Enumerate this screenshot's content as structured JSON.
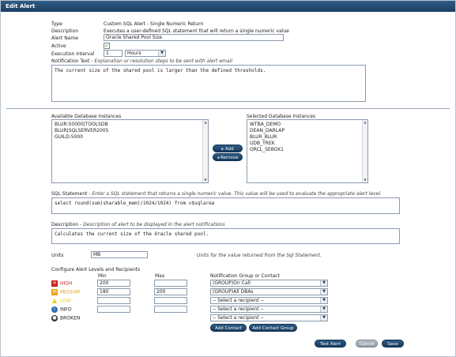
{
  "window": {
    "title": "Edit Alert"
  },
  "form": {
    "type_label": "Type",
    "type_value": "Custom SQL Alert - Single Numeric Return",
    "description_label": "Description",
    "description_value": "Executes a user-defined SQL statement that will return a single numeric value",
    "alert_name_label": "Alert Name",
    "alert_name_value": "Oracle Shared Pool Size",
    "active_label": "Active",
    "active_checked": true,
    "exec_interval_label": "Execution Interval",
    "exec_interval_value": "1",
    "exec_interval_unit": "Hours",
    "notification_text_label": "Notification Text",
    "notification_text_hint": " - Explanation or resolution steps to be sent with alert email",
    "notification_text_value": "The current size of the shared pool is larger than the defined thresholds."
  },
  "instances": {
    "available_label": "Available Database Instances",
    "available": [
      "BLUR:50000|TOOLSDB",
      "BLUR|SQLSERVER2005",
      "GUILD:5000"
    ],
    "selected_label": "Selected Database Instances",
    "selected": [
      "WTBA_DEMO",
      "DEAN_DARLAP",
      "BLUR_BLUR",
      "UDB_TREK",
      "ORCL_SEBOX1"
    ],
    "add_label": "Add",
    "remove_label": "Remove"
  },
  "sql": {
    "label": "SQL Statement",
    "hint": " - Enter a SQL statement that returns a single numeric value. This value will be used to evaluate the appropriate alert level.",
    "value": "select round(sum(sharable_mem)/1024/1024) from v$sqlarea"
  },
  "desc": {
    "label": "Description",
    "hint": " - Description of alert to be displayed in the alert notifications",
    "value": "Calculates the current size of the Oracle shared pool."
  },
  "units": {
    "label": "Units",
    "value": "MB",
    "hint": "Units for the value returned from the Sql Statement."
  },
  "levels": {
    "header": "Configure Alert Levels and Recipients",
    "min_label": "Min",
    "max_label": "Max",
    "recipient_label": "Notification Group or Contact",
    "rows": [
      {
        "name": "HIGH",
        "color": "#cc2222",
        "min": "200",
        "max": "",
        "recipient": "(GROUP)On Call"
      },
      {
        "name": "MEDIUM",
        "color": "#e8a020",
        "min": "180",
        "max": "200",
        "recipient": "(GROUP)All DBAs"
      },
      {
        "name": "LOW",
        "color": "#e6d21a",
        "min": "",
        "max": "",
        "recipient": "-- Select a recipient --"
      },
      {
        "name": "INFO",
        "color": "#2f6db5",
        "min": "",
        "max": "",
        "recipient": "-- Select a recipient --"
      },
      {
        "name": "BROKEN",
        "color": "#333333",
        "min": "",
        "max": "",
        "recipient": "-- Select a recipient --"
      }
    ],
    "add_contact_label": "Add Contact",
    "add_contact_group_label": "Add Contact Group"
  },
  "footer": {
    "test_label": "Test Alert",
    "cancel_label": "Cancel",
    "save_label": "Save"
  }
}
